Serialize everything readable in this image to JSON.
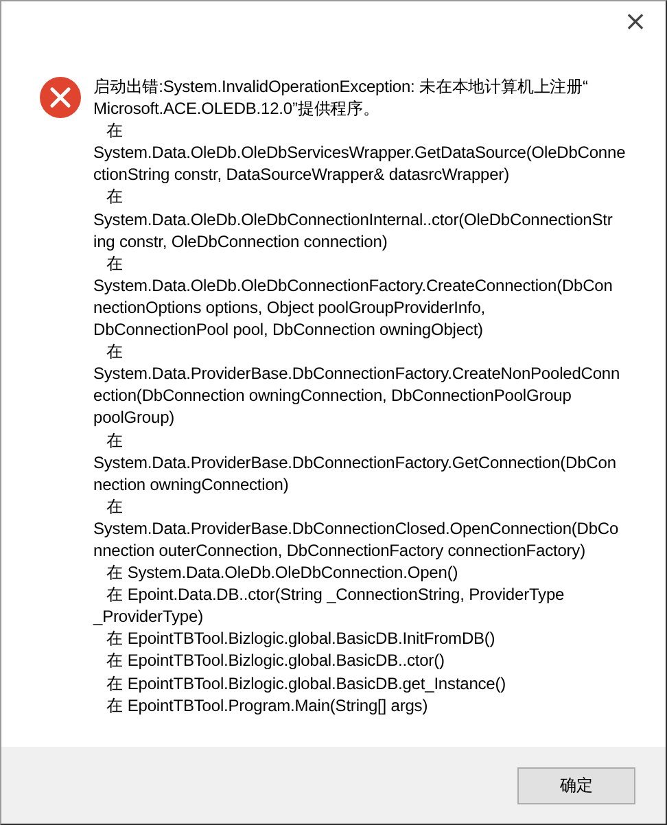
{
  "dialog": {
    "close": "×",
    "message_lines": [
      "启动出错:System.InvalidOperationException: 未在本地计算机上注册“",
      "Microsoft.ACE.OLEDB.12.0”提供程序。",
      "   在",
      "System.Data.OleDb.OleDbServicesWrapper.GetDataSource(OleDbConne",
      "ctionString constr, DataSourceWrapper& datasrcWrapper)",
      "   在",
      "System.Data.OleDb.OleDbConnectionInternal..ctor(OleDbConnectionStr",
      "ing constr, OleDbConnection connection)",
      "   在",
      "System.Data.OleDb.OleDbConnectionFactory.CreateConnection(DbCon",
      "nectionOptions options, Object poolGroupProviderInfo,",
      "DbConnectionPool pool, DbConnection owningObject)",
      "   在",
      "System.Data.ProviderBase.DbConnectionFactory.CreateNonPooledConn",
      "ection(DbConnection owningConnection, DbConnectionPoolGroup",
      "poolGroup)",
      "   在",
      "System.Data.ProviderBase.DbConnectionFactory.GetConnection(DbCon",
      "nection owningConnection)",
      "   在",
      "System.Data.ProviderBase.DbConnectionClosed.OpenConnection(DbCo",
      "nnection outerConnection, DbConnectionFactory connectionFactory)",
      "   在 System.Data.OleDb.OleDbConnection.Open()",
      "   在 Epoint.Data.DB..ctor(String _ConnectionString, ProviderType",
      "_ProviderType)",
      "   在 EpointTBTool.Bizlogic.global.BasicDB.InitFromDB()",
      "   在 EpointTBTool.Bizlogic.global.BasicDB..ctor()",
      "   在 EpointTBTool.Bizlogic.global.BasicDB.get_Instance()",
      "   在 EpointTBTool.Program.Main(String[] args)"
    ],
    "buttons": [
      "确定"
    ]
  }
}
